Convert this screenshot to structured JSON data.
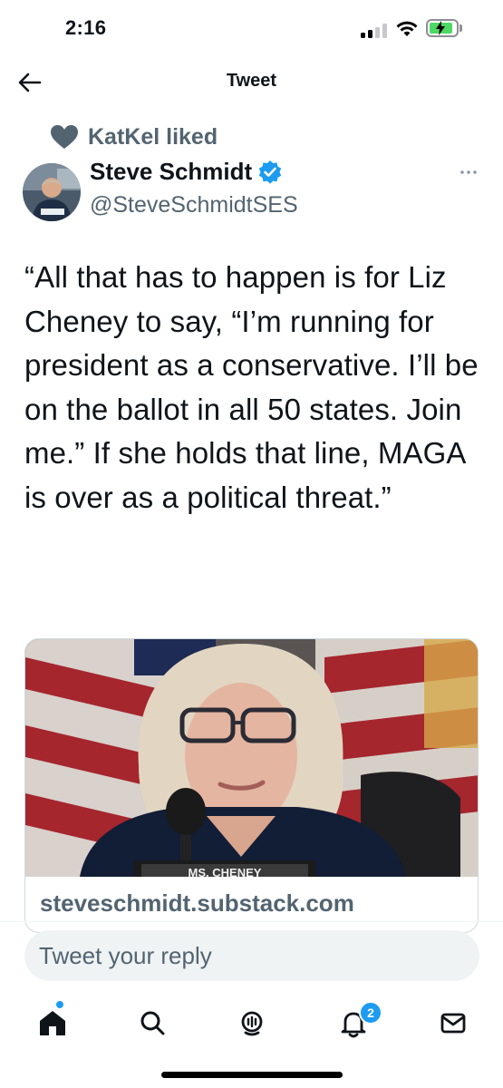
{
  "status_bar": {
    "time": "2:16"
  },
  "header": {
    "title": "Tweet"
  },
  "social_context": {
    "text": "KatKel liked"
  },
  "author": {
    "name": "Steve Schmidt",
    "handle": "@SteveSchmidtSES",
    "verified": true
  },
  "tweet": {
    "text": "“All that has to happen is for Liz Cheney to say, “I’m running for president as a conservative. I’ll be on the ballot in all 50 states. Join me.” If she holds that line, MAGA is over as a political threat.”"
  },
  "card": {
    "nameplate": "MS. CHENEY",
    "domain": "steveschmidt.substack.com"
  },
  "reply": {
    "placeholder": "Tweet your reply"
  },
  "tab_bar": {
    "items": [
      "home-icon",
      "search-icon",
      "spaces-icon",
      "notifications-icon",
      "messages-icon"
    ],
    "notifications_badge": "2"
  },
  "colors": {
    "accent": "#1d9bf0",
    "secondary_text": "#536471",
    "primary_text": "#0f1419"
  }
}
